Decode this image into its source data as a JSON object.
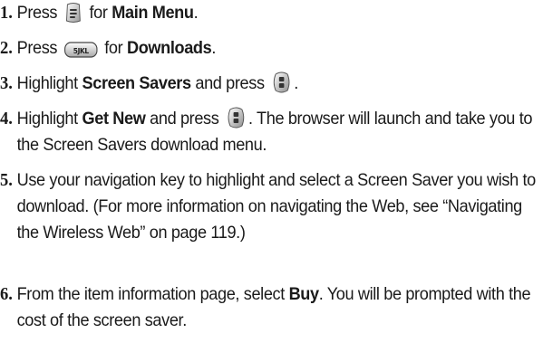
{
  "steps": [
    {
      "number": "1.",
      "parts": [
        "Press",
        "for",
        "Main Menu",
        "."
      ]
    },
    {
      "number": "2.",
      "parts": [
        "Press",
        "for",
        "Downloads",
        "."
      ]
    },
    {
      "number": "3.",
      "parts": [
        "Highlight",
        "Screen Savers",
        "and press",
        "."
      ]
    },
    {
      "number": "4.",
      "parts": [
        "Highlight",
        "Get New",
        "and press",
        ". The browser will launch and take you to the Screen Savers download menu."
      ]
    },
    {
      "number": "5.",
      "text": "Use your navigation key to highlight and select a Screen Saver you wish to download. (For more information on navigating the Web, see “Navigating the Wireless Web” on page 119.)"
    },
    {
      "number": "6.",
      "parts": [
        "From the item information page, select",
        "Buy",
        ". You will be prompted with the cost of the screen saver."
      ]
    }
  ],
  "icons": {
    "menu_key": "menu-key-icon",
    "five_key": "5-jkl-key-icon",
    "five_key_label": "5JKL",
    "ok_key": "ok-select-key-icon"
  }
}
